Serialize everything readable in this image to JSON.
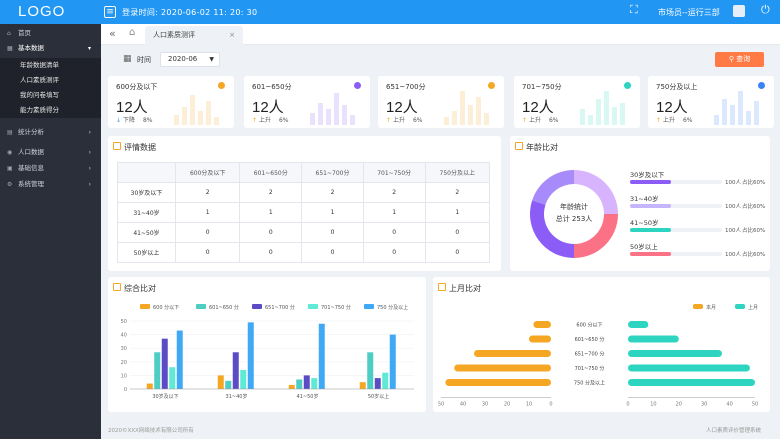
{
  "header": {
    "logo": "LOGO",
    "login_time": "登录时间:  2020-06-02 11: 20: 30",
    "user": "市场员--运行三部"
  },
  "sidebar": {
    "items": [
      {
        "label": "首页"
      },
      {
        "label": "基本数据",
        "sub": [
          "年龄数据清单",
          "人口素质测评",
          "我的问卷填写",
          "能力素质得分"
        ]
      },
      {
        "label": "统计分析"
      },
      {
        "label": "人口数据"
      },
      {
        "label": "基础信息"
      },
      {
        "label": "系统管理"
      }
    ]
  },
  "tabs": {
    "active": "人口素质测评"
  },
  "filter": {
    "label": "时间",
    "value": "2020-06",
    "search": "查询"
  },
  "kpis": [
    {
      "label": "600分及以下",
      "value": "12人",
      "trend": "下降",
      "pct": "8%",
      "color": "#f5a623"
    },
    {
      "label": "601~650分",
      "value": "12人",
      "trend": "上升",
      "pct": "6%",
      "color": "#8b5cf6"
    },
    {
      "label": "651~700分",
      "value": "12人",
      "trend": "上升",
      "pct": "6%",
      "color": "#f5a623"
    },
    {
      "label": "701~750分",
      "value": "12人",
      "trend": "上升",
      "pct": "6%",
      "color": "#2dd4bf"
    },
    {
      "label": "750分及以上",
      "value": "12人",
      "trend": "上升",
      "pct": "6%",
      "color": "#3b82f6"
    }
  ],
  "review": {
    "title": "评情数据",
    "header": [
      "",
      "600分及以下",
      "601~650分",
      "651~700分",
      "701~750分",
      "750分及以上"
    ],
    "rows": [
      [
        "30岁及以下",
        "2",
        "2",
        "2",
        "2",
        "2"
      ],
      [
        "31~40岁",
        "1",
        "1",
        "1",
        "1",
        "1"
      ],
      [
        "41~50岁",
        "0",
        "0",
        "0",
        "0",
        "0"
      ],
      [
        "50岁以上",
        "0",
        "0",
        "0",
        "0",
        "0"
      ]
    ]
  },
  "age": {
    "title": "年龄比对",
    "center_title": "年龄统计",
    "center_total": "总计  253人",
    "items": [
      {
        "label": "30岁及以下",
        "count": "100人",
        "ratio": "占比60%",
        "color": "#8b5cf6",
        "fill": 0.6
      },
      {
        "label": "31~40岁",
        "count": "100人",
        "ratio": "占比60%",
        "color": "#c4b5fd",
        "fill": 0.6
      },
      {
        "label": "41~50岁",
        "count": "100人",
        "ratio": "占比60%",
        "color": "#2dd4bf",
        "fill": 0.6
      },
      {
        "label": "50岁以上",
        "count": "100人",
        "ratio": "占比60%",
        "color": "#fb7185",
        "fill": 0.6
      }
    ],
    "donut": [
      {
        "value": 25,
        "color": "#d8b4fe"
      },
      {
        "value": 25,
        "color": "#fb7185"
      },
      {
        "value": 30,
        "color": "#8b5cf6"
      },
      {
        "value": 20,
        "color": "#a78bfa"
      }
    ]
  },
  "panels": {
    "comprehensive_title": "综合比对",
    "monthly_title": "上月比对"
  },
  "chart_data": [
    {
      "type": "bar",
      "title": "综合比对",
      "categories": [
        "30岁及以下",
        "31~40岁",
        "41~50岁",
        "50岁以上"
      ],
      "ylim": [
        0,
        50
      ],
      "yticks": [
        0,
        10,
        20,
        30,
        40,
        50
      ],
      "series": [
        {
          "name": "600 分以下",
          "color": "#f5a623",
          "values": [
            4,
            10,
            3,
            5
          ]
        },
        {
          "name": "601~650 分",
          "color": "#4ecdc4",
          "values": [
            27,
            6,
            7,
            27
          ]
        },
        {
          "name": "651~700 分",
          "color": "#5b4bc4",
          "values": [
            37,
            27,
            10,
            8
          ]
        },
        {
          "name": "701~750 分",
          "color": "#5eead4",
          "values": [
            16,
            14,
            8,
            12
          ]
        },
        {
          "name": "750 分及以上",
          "color": "#3fa9f5",
          "values": [
            43,
            49,
            48,
            40
          ]
        }
      ]
    },
    {
      "type": "bar",
      "orientation": "horizontal-butterfly",
      "title": "上月比对",
      "categories": [
        "600 分以下",
        "601~650 分",
        "651~700 分",
        "701~750 分",
        "750 分及以上"
      ],
      "xticks_left": [
        50,
        40,
        30,
        20,
        10,
        0
      ],
      "xticks_right": [
        0,
        10,
        20,
        30,
        40,
        50
      ],
      "series": [
        {
          "name": "本月",
          "color": "#f5a623",
          "values": [
            8,
            10,
            35,
            44,
            48
          ]
        },
        {
          "name": "上月",
          "color": "#2dd4bf",
          "values": [
            8,
            20,
            37,
            48,
            50
          ]
        }
      ]
    }
  ],
  "footer": {
    "left": "2020©XXX网络技术有限公司所有",
    "right": "人口素质评价管理系统"
  }
}
